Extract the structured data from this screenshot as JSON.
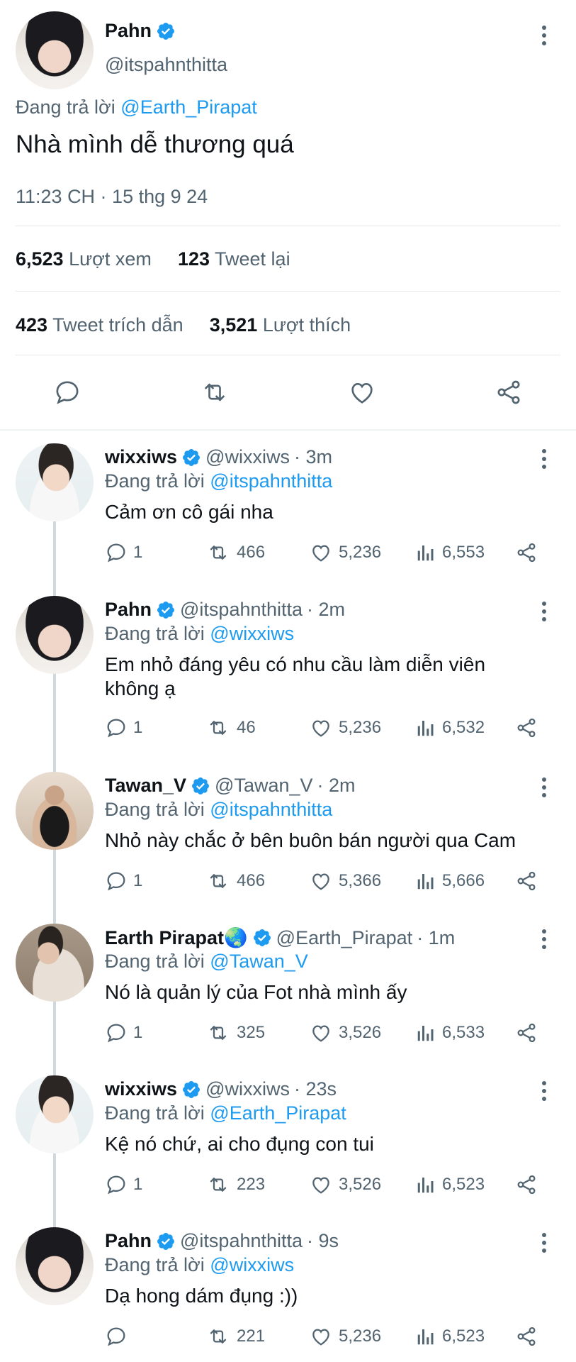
{
  "main_tweet": {
    "author_name": "Pahn",
    "author_handle": "@itspahnthitta",
    "reply_prefix": "Đang trả lời",
    "reply_to": "@Earth_Pirapat",
    "text": "Nhà mình dễ thương quá",
    "timestamp": "11:23 CH · 15 thg 9 24",
    "views_count": "6,523",
    "views_label": "Lượt xem",
    "retweets_count": "123",
    "retweets_label": "Tweet lại",
    "quotes_count": "423",
    "quotes_label": "Tweet trích dẫn",
    "likes_count": "3,521",
    "likes_label": "Lượt thích"
  },
  "replies": [
    {
      "name": "wixxiws",
      "handle": "@wixxiws",
      "time": "· 3m",
      "reply_prefix": "Đang trả lời",
      "reply_to": "@itspahnthitta",
      "text": "Cảm ơn cô gái nha",
      "replies": "1",
      "retweets": "466",
      "likes": "5,236",
      "views": "6,553",
      "avatar": "wixxiws"
    },
    {
      "name": "Pahn",
      "handle": "@itspahnthitta",
      "time": "· 2m",
      "reply_prefix": "Đang trả lời",
      "reply_to": "@wixxiws",
      "text": "Em nhỏ đáng yêu có nhu cầu làm diễn viên không ạ",
      "replies": "1",
      "retweets": "46",
      "likes": "5,236",
      "views": "6,532",
      "avatar": "pahn"
    },
    {
      "name": "Tawan_V",
      "handle": "@Tawan_V",
      "time": "· 2m",
      "reply_prefix": "Đang trả lời",
      "reply_to": "@itspahnthitta",
      "text": "Nhỏ này chắc ở bên buôn bán người qua Cam",
      "replies": "1",
      "retweets": "466",
      "likes": "5,366",
      "views": "5,666",
      "avatar": "tawan"
    },
    {
      "name": "Earth Pirapat🌏",
      "handle": "@Earth_Pirapat",
      "time": "· 1m",
      "reply_prefix": "Đang trả lời",
      "reply_to": "@Tawan_V",
      "text": "Nó là quản lý của Fot nhà mình ấy",
      "replies": "1",
      "retweets": "325",
      "likes": "3,526",
      "views": "6,533",
      "avatar": "earth"
    },
    {
      "name": "wixxiws",
      "handle": "@wixxiws",
      "time": "· 23s",
      "reply_prefix": "Đang trả lời",
      "reply_to": "@Earth_Pirapat",
      "text": "Kệ nó chứ, ai cho đụng con tui",
      "replies": "1",
      "retweets": "223",
      "likes": "3,526",
      "views": "6,523",
      "avatar": "wixxiws"
    },
    {
      "name": "Pahn",
      "handle": "@itspahnthitta",
      "time": "· 9s",
      "reply_prefix": "Đang trả lời",
      "reply_to": "@wixxiws",
      "text": "Dạ hong dám đụng :))",
      "replies": "",
      "retweets": "221",
      "likes": "5,236",
      "views": "6,523",
      "avatar": "pahn"
    }
  ],
  "colors": {
    "accent": "#1d9bf0",
    "muted": "#536471",
    "text": "#0f1419",
    "thread_line": "#cfd9de"
  }
}
